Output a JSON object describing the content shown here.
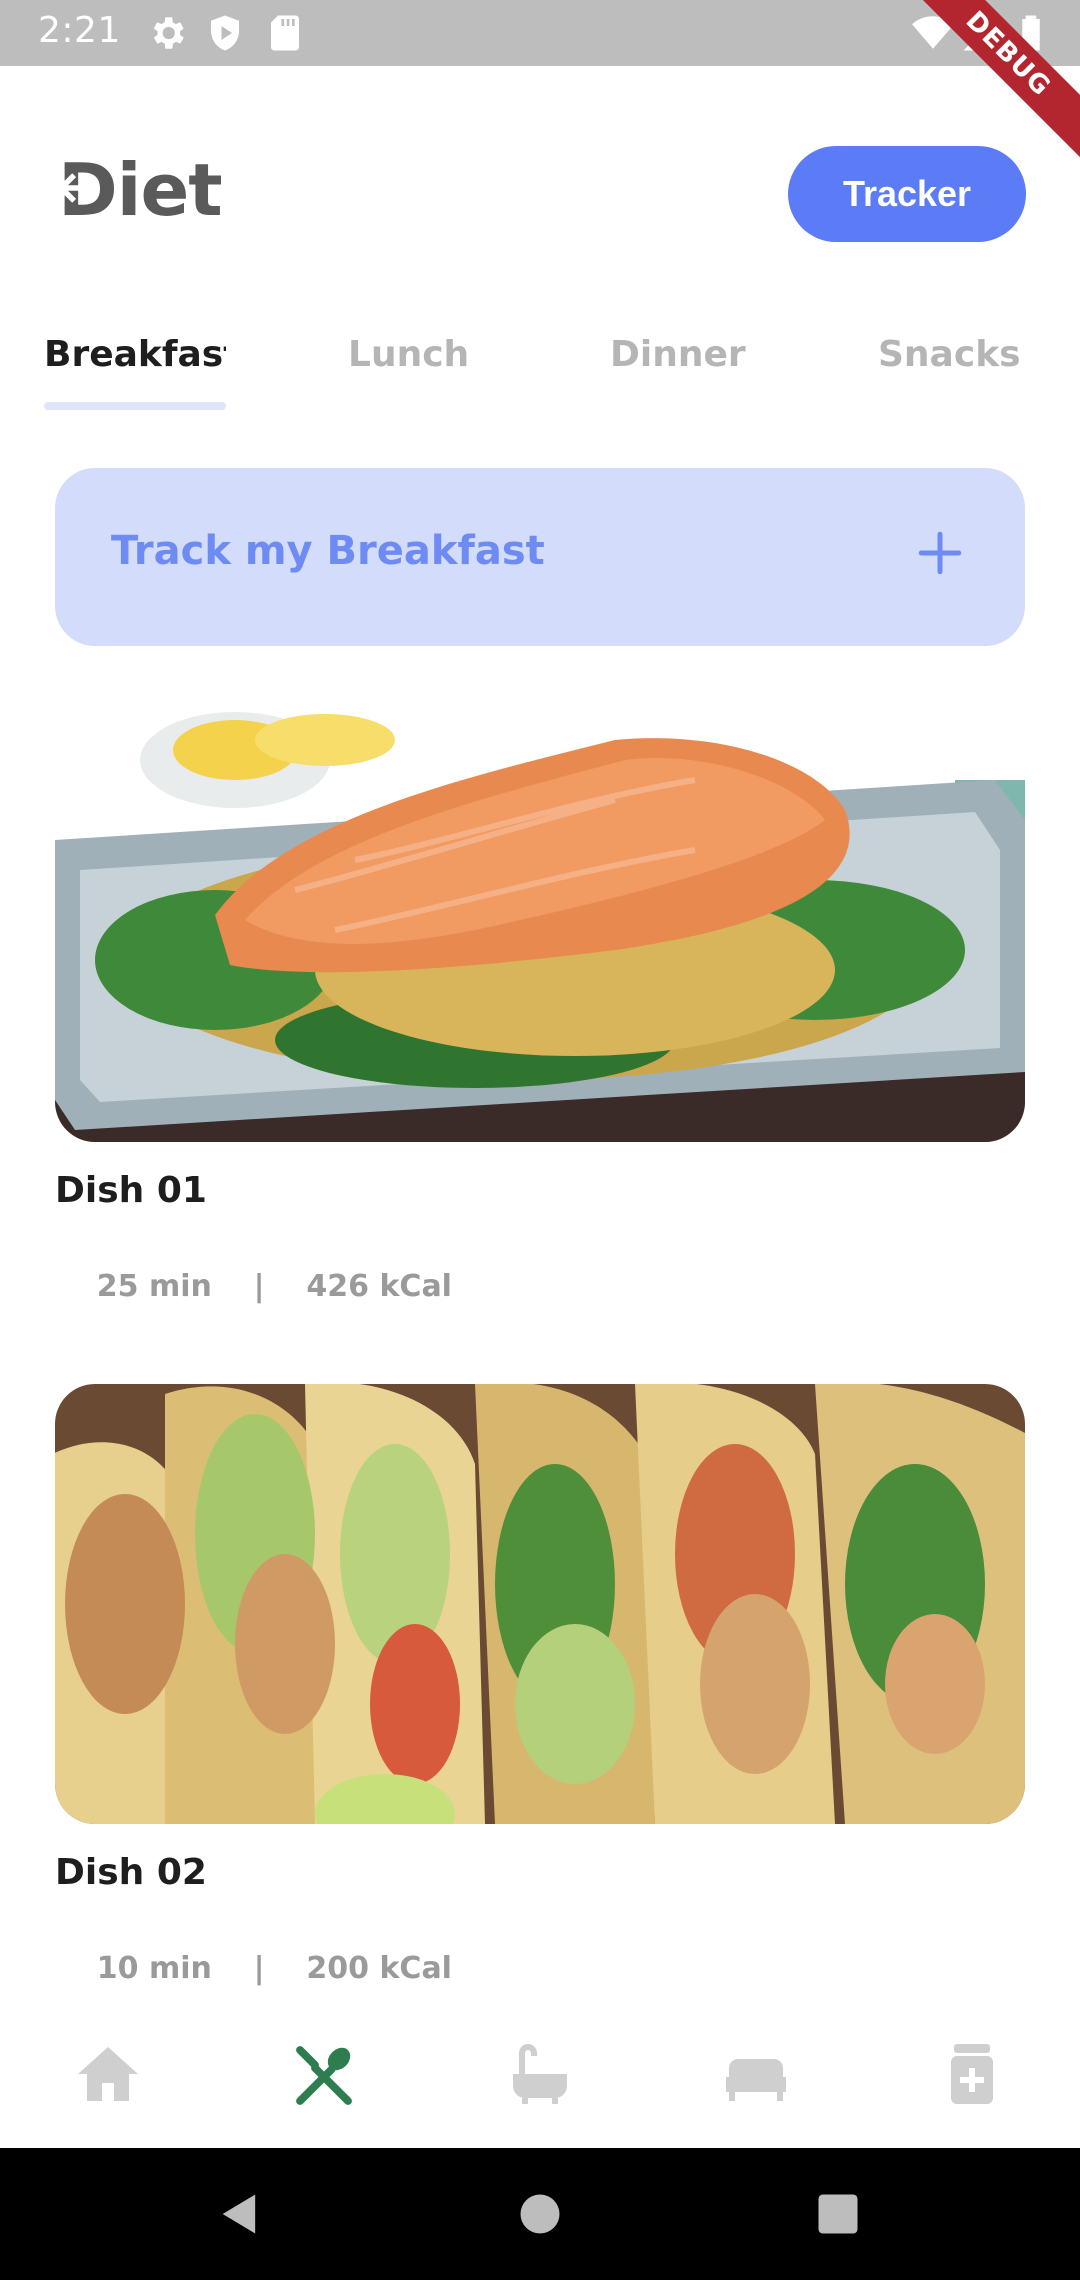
{
  "status_bar": {
    "time": "2:21",
    "debug_label": "DEBUG"
  },
  "header": {
    "title": "Diet",
    "tracker_label": "Tracker"
  },
  "tabs": [
    {
      "label": "Breakfast",
      "active": true
    },
    {
      "label": "Lunch",
      "active": false
    },
    {
      "label": "Dinner",
      "active": false
    },
    {
      "label": "Snacks",
      "active": false
    }
  ],
  "track_card": {
    "label": "Track my Breakfast"
  },
  "dishes": [
    {
      "name": "Dish 01",
      "time": "25 min",
      "separator": "|",
      "calories": "426 kCal"
    },
    {
      "name": "Dish 02",
      "time": "10 min",
      "separator": "|",
      "calories": "200 kCal"
    }
  ],
  "bottom_nav": {
    "items": [
      {
        "icon": "home-icon",
        "active": false
      },
      {
        "icon": "fork-knife-icon",
        "active": true
      },
      {
        "icon": "bathtub-icon",
        "active": false
      },
      {
        "icon": "bed-icon",
        "active": false
      },
      {
        "icon": "medicine-icon",
        "active": false
      }
    ]
  },
  "colors": {
    "accent": "#5b7cf6",
    "track_card_bg": "#d3dcfb",
    "active_nav": "#2e7d4f",
    "inactive_nav": "#cfcfcf"
  }
}
